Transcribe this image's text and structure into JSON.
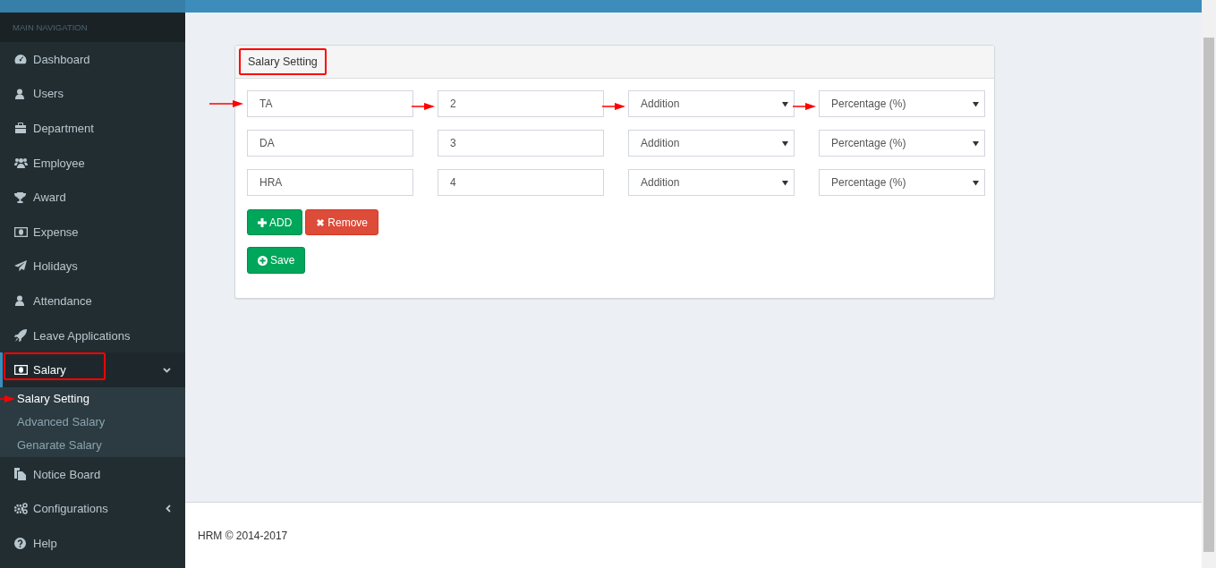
{
  "sidebar": {
    "header": "MAIN NAVIGATION",
    "items": [
      {
        "label": "Dashboard",
        "selected": false
      },
      {
        "label": "Users",
        "selected": false
      },
      {
        "label": "Department",
        "selected": false
      },
      {
        "label": "Employee",
        "selected": false
      },
      {
        "label": "Award",
        "selected": false
      },
      {
        "label": "Expense",
        "selected": false
      },
      {
        "label": "Holidays",
        "selected": false
      },
      {
        "label": "Attendance",
        "selected": false
      },
      {
        "label": "Leave Applications",
        "selected": false
      },
      {
        "label": "Salary",
        "selected": true,
        "expanded": true,
        "highlighted": true,
        "children": [
          {
            "label": "Salary Setting",
            "selected": true,
            "pointed": true
          },
          {
            "label": "Advanced Salary",
            "selected": false,
            "pointed": false
          },
          {
            "label": "Genarate Salary",
            "selected": false,
            "pointed": false
          }
        ]
      },
      {
        "label": "Notice Board",
        "selected": false
      },
      {
        "label": "Configurations",
        "selected": false,
        "expanded": false
      },
      {
        "label": "Help",
        "selected": false
      }
    ]
  },
  "card": {
    "title": "Salary Setting",
    "title_highlighted": true,
    "rows": [
      {
        "name": "TA",
        "amount": "2",
        "operation": "Addition",
        "type": "Percentage (%)",
        "arrows": true
      },
      {
        "name": "DA",
        "amount": "3",
        "operation": "Addition",
        "type": "Percentage (%)",
        "arrows": false
      },
      {
        "name": "HRA",
        "amount": "4",
        "operation": "Addition",
        "type": "Percentage (%)",
        "arrows": false
      }
    ],
    "buttons": [
      {
        "label": "ADD",
        "kind": "add"
      },
      {
        "label": "Remove",
        "kind": "remove"
      }
    ],
    "save": {
      "label": "Save"
    }
  },
  "footer": {
    "text": "HRM © 2014-2017"
  }
}
